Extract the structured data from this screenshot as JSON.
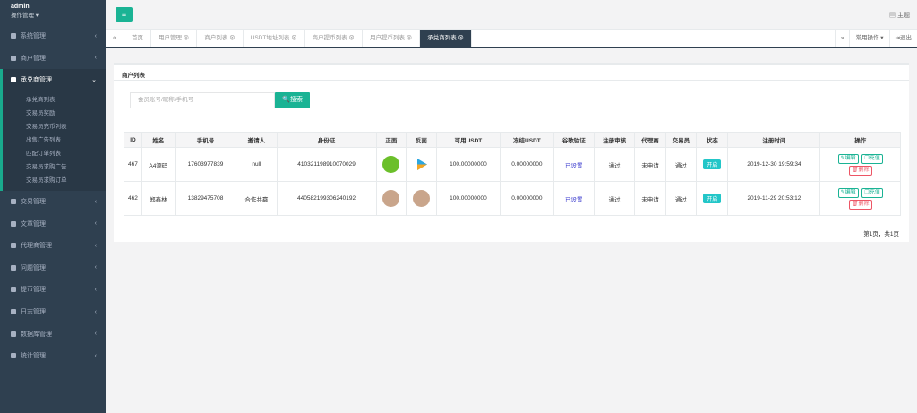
{
  "sidebar": {
    "username": "admin",
    "role": "操作管理 ▾",
    "items": [
      {
        "label": "系统管理",
        "icon": "gear-icon"
      },
      {
        "label": "商户管理",
        "icon": "user-icon"
      },
      {
        "label": "承兑商管理",
        "icon": "user-icon"
      },
      {
        "label": "交易管理",
        "icon": "image-icon"
      },
      {
        "label": "文章管理",
        "icon": "copy-icon"
      },
      {
        "label": "代理商管理",
        "icon": "user-icon"
      },
      {
        "label": "问题管理",
        "icon": "comment-icon"
      },
      {
        "label": "提币管理",
        "icon": "user-icon"
      },
      {
        "label": "日志管理",
        "icon": "list-icon"
      },
      {
        "label": "数据库管理",
        "icon": "database-icon"
      },
      {
        "label": "统计管理",
        "icon": "chart-icon"
      }
    ],
    "sub_items": [
      "承兑商列表",
      "交易员奖励",
      "交易员充币列表",
      "出售广告列表",
      "匹配订单列表",
      "交易员求购广告",
      "交易员求购订单"
    ]
  },
  "topbar": {
    "menu_icon": "bars-icon",
    "theme_label": "主题"
  },
  "tabs": {
    "items": [
      "首页",
      "用户管理 ⊗",
      "商户列表 ⊗",
      "USDT地址列表 ⊗",
      "商户提币列表 ⊗",
      "用户提币列表 ⊗",
      "承兑商列表 ⊗"
    ],
    "active_index": 6,
    "common_ops": "常用操作 ▾",
    "logout": "退出"
  },
  "panel": {
    "title": "商户列表",
    "search_placeholder": "会员账号/昵称/手机号",
    "search_button": "搜索"
  },
  "table": {
    "headers": [
      "ID",
      "姓名",
      "手机号",
      "邀请人",
      "身份证",
      "正面",
      "反面",
      "可用USDT",
      "冻结USDT",
      "谷歌验证",
      "注册审核",
      "代理商",
      "交易员",
      "状态",
      "注册时间",
      "操作"
    ],
    "rows": [
      {
        "id": "467",
        "name": "A4源码",
        "phone": "17603977839",
        "inviter": "null",
        "idcard": "410321198910070029",
        "front_img": "iqiyi-logo-icon",
        "back_img": "video-play-icon",
        "usdt_avail": "100.00000000",
        "usdt_frozen": "0.00000000",
        "google": "已设置",
        "review": "通过",
        "agent": "未申请",
        "trader": "通过",
        "status": "开启",
        "reg_time": "2019-12-30 19:59:34"
      },
      {
        "id": "462",
        "name": "郑鑫林",
        "phone": "13829475708",
        "inviter": "合作共赢",
        "idcard": "440582199306240192",
        "front_img": "photo-icon",
        "back_img": "photo-icon",
        "usdt_avail": "100.00000000",
        "usdt_frozen": "0.00000000",
        "google": "已设置",
        "review": "通过",
        "agent": "未申请",
        "trader": "通过",
        "status": "开启",
        "reg_time": "2019-11-29 20:53:12"
      }
    ],
    "actions": {
      "edit": "编辑",
      "recharge": "充值",
      "delete": "删除"
    }
  },
  "pager": "第1页，共1页"
}
